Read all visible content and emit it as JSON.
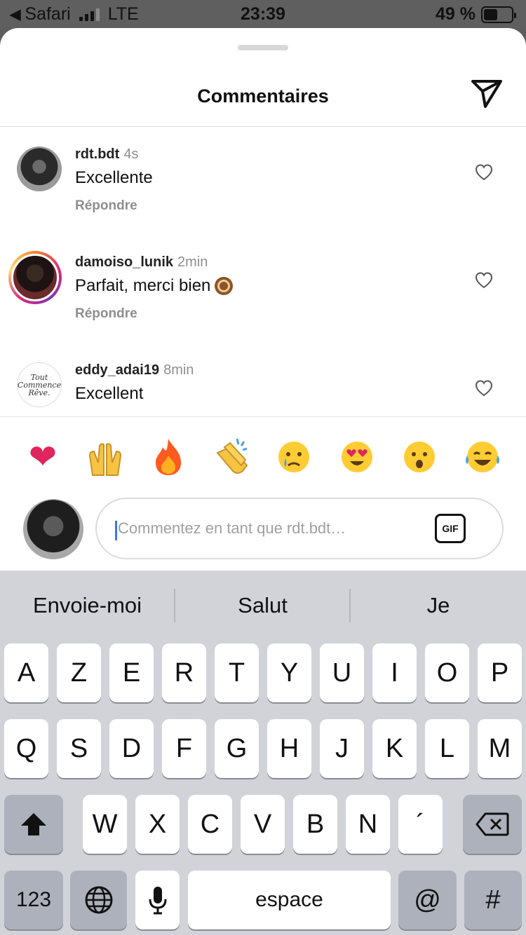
{
  "status_bar": {
    "back_app": "Safari",
    "network": "LTE",
    "time": "23:39",
    "battery_text": "49 %",
    "battery_level": 0.49,
    "signal_bars_active": 3,
    "signal_bars_total": 4
  },
  "sheet": {
    "title": "Commentaires"
  },
  "comments": [
    {
      "username": "rdt.bdt",
      "time": "4s",
      "text": "Excellente",
      "reply": "Répondre",
      "avatar_icon": "profile-photo"
    },
    {
      "username": "damoiso_lunik",
      "time": "2min",
      "text": "Parfait, merci bien",
      "emoji": "ok-hand-emoji",
      "reply": "Répondre",
      "avatar_icon": "story-ring-photo"
    },
    {
      "username": "eddy_adai19",
      "time": "8min",
      "text": "Excellent",
      "avatar_icon": "logo-photo",
      "avatar_logo": "Tout Commence par un Rêve."
    }
  ],
  "reactions": [
    "heart",
    "raised-hands",
    "fire",
    "clapping-hands",
    "crying-face",
    "heart-eyes-face",
    "astonished-face",
    "tears-of-joy-face"
  ],
  "comment_input": {
    "placeholder": "Commentez en tant que rdt.bdt…",
    "gif_label": "GIF"
  },
  "keyboard": {
    "predictions": [
      "Envoie-moi",
      "Salut",
      "Je"
    ],
    "row1": [
      "A",
      "Z",
      "E",
      "R",
      "T",
      "Y",
      "U",
      "I",
      "O",
      "P"
    ],
    "row2": [
      "Q",
      "S",
      "D",
      "F",
      "G",
      "H",
      "J",
      "K",
      "L",
      "M"
    ],
    "row3": [
      "W",
      "X",
      "C",
      "V",
      "B",
      "N",
      "´"
    ],
    "numbers_label": "123",
    "space_label": "espace",
    "at_label": "@",
    "hash_label": "#"
  }
}
